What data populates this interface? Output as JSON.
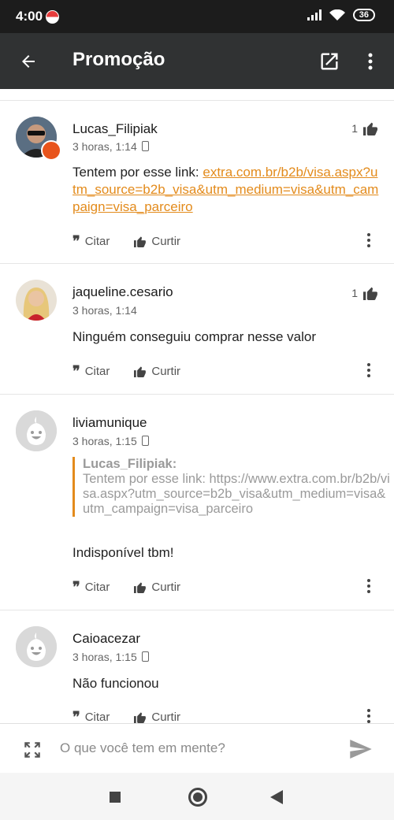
{
  "status_bar": {
    "time": "4:00",
    "battery": "36"
  },
  "toolbar": {
    "title": "Promoção"
  },
  "actions": {
    "quote": "Citar",
    "like": "Curtir"
  },
  "posts": [
    {
      "username": "Lucas_Filipiak",
      "time": "3 horas, 1:14",
      "likes": "1",
      "text_prefix": "Tentem por esse link: ",
      "link": "extra.com.br/b2b/visa.aspx?utm_source=b2b_visa&utm_medium=visa&utm_campaign=visa_parceiro"
    },
    {
      "username": "jaqueline.cesario",
      "time": "3 horas, 1:14",
      "likes": "1",
      "text": "Ninguém conseguiu comprar nesse valor"
    },
    {
      "username": "liviamunique",
      "time": "3 horas, 1:15",
      "quote_author": "Lucas_Filipiak:",
      "quote_text": "Tentem por esse link: https://www.extra.com.br/b2b/visa.aspx?utm_source=b2b_visa&utm_medium=visa&utm_campaign=visa_parceiro",
      "text": "Indisponível tbm!"
    },
    {
      "username": "Caioacezar",
      "time": "3 horas, 1:15",
      "text": "Não funcionou"
    }
  ],
  "composer": {
    "placeholder": "O que você tem em mente?"
  }
}
